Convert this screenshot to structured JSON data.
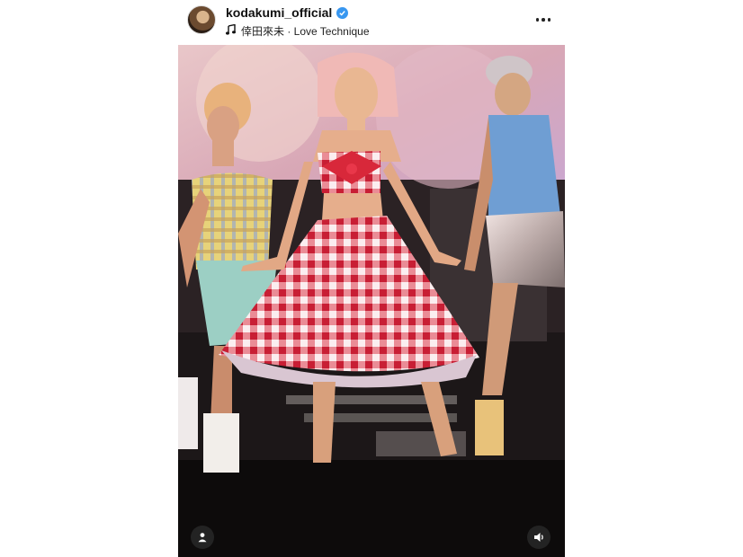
{
  "post": {
    "username": "kodakumi_official",
    "verified": true,
    "audio_label": "倖田來未 · Love Technique"
  },
  "icons": {
    "avatar": "profile-avatar",
    "verified": "verified-badge-icon",
    "music": "music-note-icon",
    "more": "more-options-icon",
    "user_tags": "user-tag-icon",
    "sound": "speaker-icon"
  },
  "colors": {
    "verified_blue": "#3897f0",
    "gingham_red": "#d8283a"
  }
}
